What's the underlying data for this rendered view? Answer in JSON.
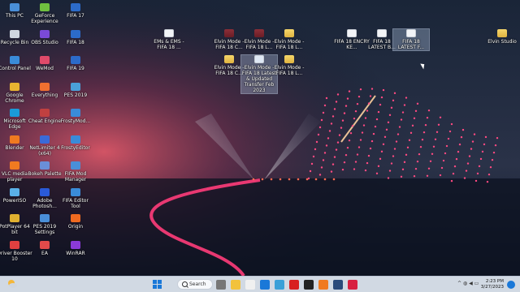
{
  "desktop_icons": [
    {
      "id": "this-pc",
      "label": "This PC",
      "x": 1
    },
    {
      "id": "geforce",
      "label": "GeForce Experience"
    },
    {
      "id": "fifa17",
      "label": "FIFA 17"
    },
    {
      "id": "recycle",
      "label": "Recycle Bin"
    },
    {
      "id": "obs",
      "label": "OBS Studio"
    },
    {
      "id": "fifa18",
      "label": "FIFA 18"
    },
    {
      "id": "control",
      "label": "Control Panel"
    },
    {
      "id": "wemod",
      "label": "WeMod"
    },
    {
      "id": "fifa19",
      "label": "FIFA 19"
    },
    {
      "id": "chrome",
      "label": "Google Chrome"
    },
    {
      "id": "everything",
      "label": "Everything"
    },
    {
      "id": "pes2019",
      "label": "PES 2019"
    },
    {
      "id": "edge",
      "label": "Microsoft Edge"
    },
    {
      "id": "cheat",
      "label": "Cheat Engine"
    },
    {
      "id": "frostymod",
      "label": "FrostyMod..."
    },
    {
      "id": "blender",
      "label": "Blender"
    },
    {
      "id": "netlimiter",
      "label": "NetLimiter 4 (x64)"
    },
    {
      "id": "frostyeditor",
      "label": "FrostyEditor"
    },
    {
      "id": "vlc",
      "label": "VLC media player"
    },
    {
      "id": "bokeh",
      "label": "Bokeh Palette"
    },
    {
      "id": "fifamod",
      "label": "FIFA Mod Manager"
    },
    {
      "id": "poweriso",
      "label": "PowerISO"
    },
    {
      "id": "photoshop",
      "label": "Adobe Photosh..."
    },
    {
      "id": "fifaeditor",
      "label": "FIFA Editor Tool"
    },
    {
      "id": "potplayer",
      "label": "PotPlayer 64 bit"
    },
    {
      "id": "pessettings",
      "label": "PES 2019 Settings"
    },
    {
      "id": "origin",
      "label": "Origin"
    },
    {
      "id": "driverbooster",
      "label": "Driver Booster 10"
    },
    {
      "id": "ea",
      "label": "EA"
    },
    {
      "id": "winrar",
      "label": "WinRAR"
    }
  ],
  "right_icons": {
    "ems": "EMs & EMS - FIFA 18 ...",
    "elvin1": "Elvin Mode - FIFA 18 C...",
    "elvin2": "Elvin Mode - FIFA 18 L...",
    "elvin3": "Elvin Mode - FIFA 18 L...",
    "fifa18encry": "FIFA 18 ENCRY KE...",
    "fifa18latest1": "FIFA 18 LATEST B...",
    "fifa18latest2": "FIFA 18 LATEST F...",
    "elvinstudio": "Elvin Studio",
    "elvin4": "Elvin Mode - FIFA 18 C...",
    "elvin5": "Elvin Mode - FIFA 18 Latest & Updated Transfer Feb 2023",
    "elvin6": "Elvin Mode - FIFA 18 L..."
  },
  "taskbar": {
    "search_label": "Search",
    "time": "2:23 PM",
    "date": "3/27/2023",
    "pinned": [
      "file-explorer",
      "store",
      "edge",
      "photos",
      "media-player",
      "malwarebytes",
      "wps",
      "steam",
      "opera",
      "settings"
    ]
  },
  "colors": {
    "accent": "#1a78d8",
    "folder": "#f5d66b",
    "wallpaper_glow": "#ff3c6e"
  }
}
